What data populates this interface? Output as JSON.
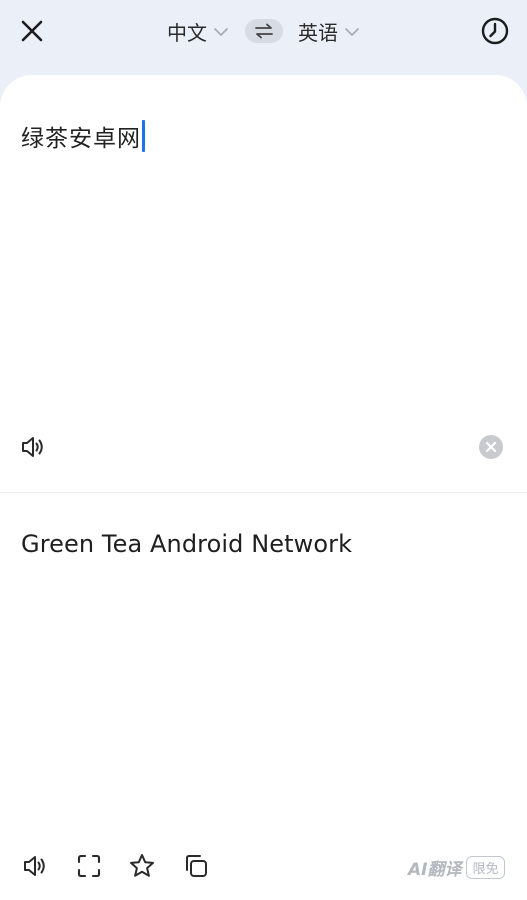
{
  "header": {
    "source_lang": "中文",
    "target_lang": "英语",
    "icons": {
      "close": "close-icon",
      "swap": "swap-icon",
      "history": "history-icon",
      "chevron": "chevron-down-icon"
    }
  },
  "input": {
    "text": "绿茶安卓网",
    "icons": {
      "speak": "speaker-icon",
      "clear": "clear-icon"
    }
  },
  "output": {
    "text": "Green Tea Android Network",
    "icons": {
      "speak": "speaker-icon",
      "fullscreen": "fullscreen-icon",
      "favorite": "star-icon",
      "copy": "copy-icon"
    },
    "badge": {
      "label": "AI翻译",
      "tag": "限免"
    }
  },
  "colors": {
    "background": "#ebf0f8",
    "card": "#ffffff",
    "caret": "#1a73e8",
    "icon": "#2a2a2a",
    "muted": "#b4b8bf"
  }
}
